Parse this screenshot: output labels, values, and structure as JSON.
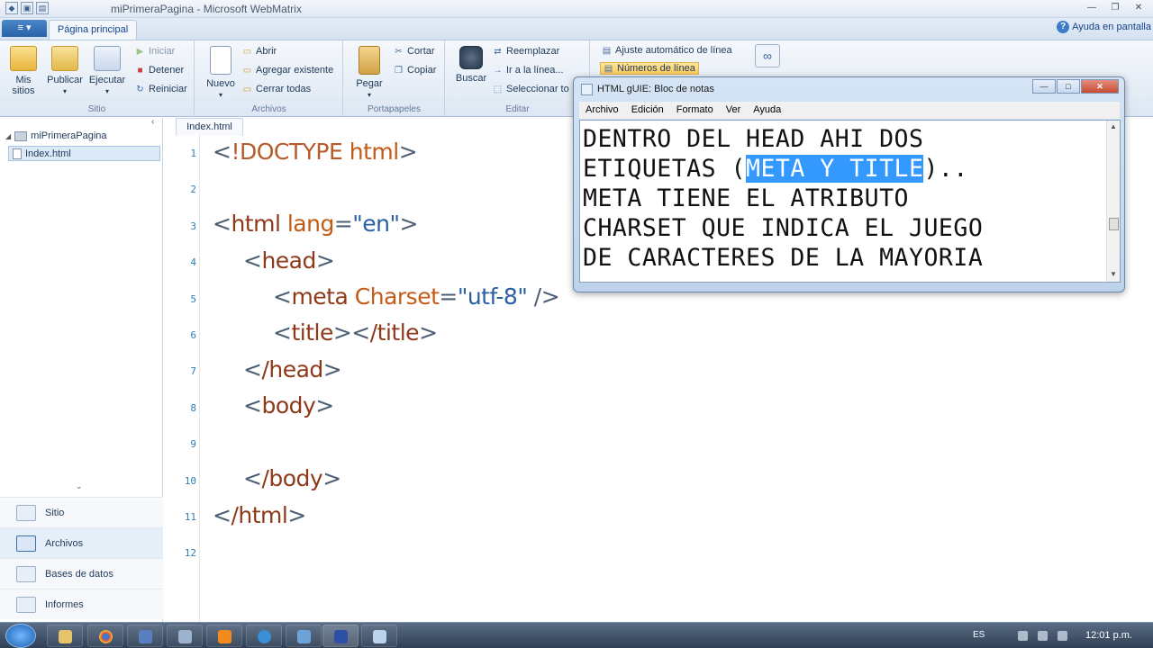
{
  "window": {
    "title": "miPrimeraPagina - Microsoft WebMatrix"
  },
  "ribbon": {
    "app_menu": "≡ ▾",
    "tab": "Página principal",
    "help": "Ayuda en pantalla",
    "groups": {
      "sitio": {
        "label": "Sitio",
        "mis_sitios": "Mis sitios",
        "publicar": "Publicar",
        "ejecutar": "Ejecutar",
        "iniciar": "Iniciar",
        "detener": "Detener",
        "reiniciar": "Reiniciar"
      },
      "archivos": {
        "label": "Archivos",
        "nuevo": "Nuevo",
        "abrir": "Abrir",
        "agregar": "Agregar existente",
        "cerrar": "Cerrar todas"
      },
      "portapapeles": {
        "label": "Portapapeles",
        "pegar": "Pegar",
        "cortar": "Cortar",
        "copiar": "Copiar"
      },
      "editar": {
        "label": "Editar",
        "buscar": "Buscar",
        "reemplazar": "Reemplazar",
        "ir_linea": "Ir a la línea...",
        "seleccionar": "Seleccionar to"
      },
      "vista": {
        "ajuste": "Ajuste automático de línea",
        "numeros": "Números de línea"
      }
    }
  },
  "sidebar": {
    "tree_root": "miPrimeraPagina",
    "tree_file": "Index.html",
    "workspaces": [
      "Sitio",
      "Archivos",
      "Bases de datos",
      "Informes"
    ]
  },
  "editor": {
    "tab": "Index.html",
    "line_numbers": [
      "1",
      "2",
      "3",
      "4",
      "5",
      "6",
      "7",
      "8",
      "9",
      "10",
      "11",
      "12"
    ],
    "code": {
      "l1_doctype": "!DOCTYPE",
      "l1_html": "html",
      "l3_tag": "html",
      "l3_attr": "lang",
      "l3_val": "\"en\"",
      "l4": "head",
      "l5_tag": "meta",
      "l5_attr": "Charset",
      "l5_val": "\"utf-8\"",
      "l6_open": "title",
      "l6_close": "/title",
      "l7": "/head",
      "l8": "body",
      "l10": "/body",
      "l11": "/html"
    }
  },
  "notepad": {
    "title": "HTML gUIE: Bloc de notas",
    "menu": [
      "Archivo",
      "Edición",
      "Formato",
      "Ver",
      "Ayuda"
    ],
    "line1": "DENTRO DEL HEAD AHI DOS",
    "line2_pre": "ETIQUETAS (",
    "line2_sel": "META Y TITLE",
    "line2_post": ")..",
    "line3": "META TIENE EL ATRIBUTO",
    "line4": "CHARSET QUE INDICA EL JUEGO",
    "line5": "DE CARACTERES DE LA MAYORIA"
  },
  "taskbar": {
    "lang": "ES",
    "clock": "12:01 p.m."
  },
  "colors": {
    "selection": "#3399ff",
    "ribbon_highlight": "#f8c95c",
    "line_number": "#2f7fb6"
  }
}
